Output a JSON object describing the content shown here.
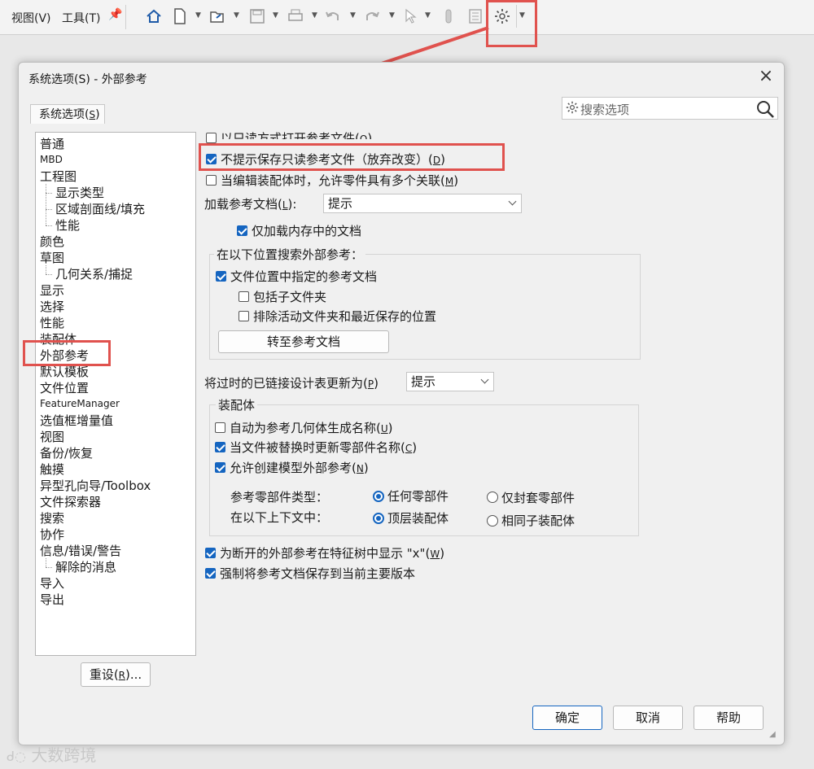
{
  "topbar": {
    "menu_view": "视图(V)",
    "menu_tools": "工具(T)",
    "icons": [
      "home-icon",
      "new-doc-icon",
      "open-icon",
      "save-icon",
      "print-icon",
      "undo-icon",
      "redo-icon",
      "select-icon",
      "rebuild-icon",
      "file-props-icon",
      "options-gear-icon"
    ]
  },
  "dialog": {
    "title": "系统选项(S) - 外部参考",
    "tab_label": "系统选项(",
    "tab_key": "S",
    "tab_end": ")",
    "search_placeholder": "搜索选项",
    "reset_label": "重设(",
    "reset_key": "R",
    "reset_end": ")...",
    "ok_label": "确定",
    "cancel_label": "取消",
    "help_label": "帮助"
  },
  "tree": {
    "items": [
      {
        "label": "普通",
        "level": 1
      },
      {
        "label": "MBD",
        "level": 1,
        "small": true
      },
      {
        "label": "工程图",
        "level": 1
      },
      {
        "label": "显示类型",
        "level": 2
      },
      {
        "label": "区域剖面线/填充",
        "level": 2
      },
      {
        "label": "性能",
        "level": 2
      },
      {
        "label": "颜色",
        "level": 1
      },
      {
        "label": "草图",
        "level": 1
      },
      {
        "label": "几何关系/捕捉",
        "level": 2
      },
      {
        "label": "显示",
        "level": 1
      },
      {
        "label": "选择",
        "level": 1
      },
      {
        "label": "性能",
        "level": 1
      },
      {
        "label": "装配体",
        "level": 1
      },
      {
        "label": "外部参考",
        "level": 1,
        "selected": true
      },
      {
        "label": "默认模板",
        "level": 1
      },
      {
        "label": "文件位置",
        "level": 1
      },
      {
        "label": "FeatureManager",
        "level": 1,
        "small": true
      },
      {
        "label": "选值框增量值",
        "level": 1
      },
      {
        "label": "视图",
        "level": 1
      },
      {
        "label": "备份/恢复",
        "level": 1
      },
      {
        "label": "触摸",
        "level": 1
      },
      {
        "label": "异型孔向导/Toolbox",
        "level": 1
      },
      {
        "label": "文件探索器",
        "level": 1
      },
      {
        "label": "搜索",
        "level": 1
      },
      {
        "label": "协作",
        "level": 1
      },
      {
        "label": "信息/错误/警告",
        "level": 1
      },
      {
        "label": "解除的消息",
        "level": 2
      },
      {
        "label": "导入",
        "level": 1
      },
      {
        "label": "导出",
        "level": 1
      }
    ]
  },
  "options": {
    "open_readonly": {
      "label": "以只读方式打开参考文件",
      "key": "O",
      "checked": false
    },
    "no_prompt_save": {
      "label": "不提示保存只读参考文件（放弃改变）",
      "key": "D",
      "checked": true
    },
    "multi_context": {
      "label": "当编辑装配体时，允许零件具有多个关联",
      "key": "M",
      "checked": false
    },
    "load_ref_label": "加载参考文档(",
    "load_ref_key": "L",
    "load_ref_end": "):",
    "load_ref_value": "提示",
    "load_memory_only": {
      "label": "仅加载内存中的文档",
      "checked": true
    },
    "search_group_title": "在以下位置搜索外部参考：",
    "file_locations": {
      "label": "文件位置中指定的参考文档",
      "checked": true
    },
    "include_subfolders": {
      "label": "包括子文件夹",
      "checked": false
    },
    "exclude_active": {
      "label": "排除活动文件夹和最近保存的位置",
      "checked": false
    },
    "goto_ref_button": "转至参考文档",
    "update_design_table_label": "将过时的已链接设计表更新为(",
    "update_design_table_key": "P",
    "update_design_table_end": ")",
    "update_design_table_value": "提示",
    "assembly_group_title": "装配体",
    "auto_name_geometry": {
      "label": "自动为参考几何体生成名称",
      "key": "U",
      "checked": false
    },
    "update_component_names": {
      "label": "当文件被替换时更新零部件名称",
      "key": "C",
      "checked": true
    },
    "allow_external_refs": {
      "label": "允许创建模型外部参考",
      "key": "N",
      "checked": true
    },
    "ref_component_type_label": "参考零部件类型：",
    "ref_any": {
      "label": "任何零部件",
      "selected": true
    },
    "ref_envelope": {
      "label": "仅封套零部件",
      "selected": false
    },
    "context_label": "在以下上下文中：",
    "context_top": {
      "label": "顶层装配体",
      "selected": true
    },
    "context_same": {
      "label": "相同子装配体",
      "selected": false
    },
    "show_x_broken": {
      "label": "为断开的外部参考在特征树中显示 \"x\"",
      "key": "W",
      "checked": true
    },
    "force_save_version": {
      "label": "强制将参考文档保存到当前主要版本",
      "checked": true
    }
  },
  "watermark": "大数跨境",
  "colors": {
    "accent": "#1565c0",
    "highlight_box": "#e0524e"
  }
}
